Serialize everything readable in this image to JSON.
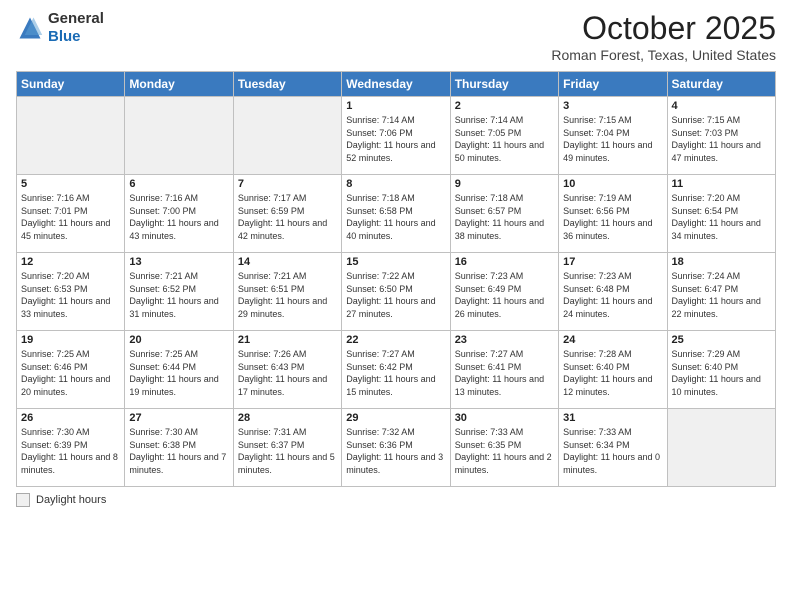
{
  "header": {
    "logo_general": "General",
    "logo_blue": "Blue",
    "month": "October 2025",
    "location": "Roman Forest, Texas, United States"
  },
  "days_of_week": [
    "Sunday",
    "Monday",
    "Tuesday",
    "Wednesday",
    "Thursday",
    "Friday",
    "Saturday"
  ],
  "weeks": [
    [
      {
        "day": "",
        "empty": true
      },
      {
        "day": "",
        "empty": true
      },
      {
        "day": "",
        "empty": true
      },
      {
        "day": "1",
        "sunrise": "7:14 AM",
        "sunset": "7:06 PM",
        "daylight": "11 hours and 52 minutes."
      },
      {
        "day": "2",
        "sunrise": "7:14 AM",
        "sunset": "7:05 PM",
        "daylight": "11 hours and 50 minutes."
      },
      {
        "day": "3",
        "sunrise": "7:15 AM",
        "sunset": "7:04 PM",
        "daylight": "11 hours and 49 minutes."
      },
      {
        "day": "4",
        "sunrise": "7:15 AM",
        "sunset": "7:03 PM",
        "daylight": "11 hours and 47 minutes."
      }
    ],
    [
      {
        "day": "5",
        "sunrise": "7:16 AM",
        "sunset": "7:01 PM",
        "daylight": "11 hours and 45 minutes."
      },
      {
        "day": "6",
        "sunrise": "7:16 AM",
        "sunset": "7:00 PM",
        "daylight": "11 hours and 43 minutes."
      },
      {
        "day": "7",
        "sunrise": "7:17 AM",
        "sunset": "6:59 PM",
        "daylight": "11 hours and 42 minutes."
      },
      {
        "day": "8",
        "sunrise": "7:18 AM",
        "sunset": "6:58 PM",
        "daylight": "11 hours and 40 minutes."
      },
      {
        "day": "9",
        "sunrise": "7:18 AM",
        "sunset": "6:57 PM",
        "daylight": "11 hours and 38 minutes."
      },
      {
        "day": "10",
        "sunrise": "7:19 AM",
        "sunset": "6:56 PM",
        "daylight": "11 hours and 36 minutes."
      },
      {
        "day": "11",
        "sunrise": "7:20 AM",
        "sunset": "6:54 PM",
        "daylight": "11 hours and 34 minutes."
      }
    ],
    [
      {
        "day": "12",
        "sunrise": "7:20 AM",
        "sunset": "6:53 PM",
        "daylight": "11 hours and 33 minutes."
      },
      {
        "day": "13",
        "sunrise": "7:21 AM",
        "sunset": "6:52 PM",
        "daylight": "11 hours and 31 minutes."
      },
      {
        "day": "14",
        "sunrise": "7:21 AM",
        "sunset": "6:51 PM",
        "daylight": "11 hours and 29 minutes."
      },
      {
        "day": "15",
        "sunrise": "7:22 AM",
        "sunset": "6:50 PM",
        "daylight": "11 hours and 27 minutes."
      },
      {
        "day": "16",
        "sunrise": "7:23 AM",
        "sunset": "6:49 PM",
        "daylight": "11 hours and 26 minutes."
      },
      {
        "day": "17",
        "sunrise": "7:23 AM",
        "sunset": "6:48 PM",
        "daylight": "11 hours and 24 minutes."
      },
      {
        "day": "18",
        "sunrise": "7:24 AM",
        "sunset": "6:47 PM",
        "daylight": "11 hours and 22 minutes."
      }
    ],
    [
      {
        "day": "19",
        "sunrise": "7:25 AM",
        "sunset": "6:46 PM",
        "daylight": "11 hours and 20 minutes."
      },
      {
        "day": "20",
        "sunrise": "7:25 AM",
        "sunset": "6:44 PM",
        "daylight": "11 hours and 19 minutes."
      },
      {
        "day": "21",
        "sunrise": "7:26 AM",
        "sunset": "6:43 PM",
        "daylight": "11 hours and 17 minutes."
      },
      {
        "day": "22",
        "sunrise": "7:27 AM",
        "sunset": "6:42 PM",
        "daylight": "11 hours and 15 minutes."
      },
      {
        "day": "23",
        "sunrise": "7:27 AM",
        "sunset": "6:41 PM",
        "daylight": "11 hours and 13 minutes."
      },
      {
        "day": "24",
        "sunrise": "7:28 AM",
        "sunset": "6:40 PM",
        "daylight": "11 hours and 12 minutes."
      },
      {
        "day": "25",
        "sunrise": "7:29 AM",
        "sunset": "6:40 PM",
        "daylight": "11 hours and 10 minutes."
      }
    ],
    [
      {
        "day": "26",
        "sunrise": "7:30 AM",
        "sunset": "6:39 PM",
        "daylight": "11 hours and 8 minutes."
      },
      {
        "day": "27",
        "sunrise": "7:30 AM",
        "sunset": "6:38 PM",
        "daylight": "11 hours and 7 minutes."
      },
      {
        "day": "28",
        "sunrise": "7:31 AM",
        "sunset": "6:37 PM",
        "daylight": "11 hours and 5 minutes."
      },
      {
        "day": "29",
        "sunrise": "7:32 AM",
        "sunset": "6:36 PM",
        "daylight": "11 hours and 3 minutes."
      },
      {
        "day": "30",
        "sunrise": "7:33 AM",
        "sunset": "6:35 PM",
        "daylight": "11 hours and 2 minutes."
      },
      {
        "day": "31",
        "sunrise": "7:33 AM",
        "sunset": "6:34 PM",
        "daylight": "11 hours and 0 minutes."
      },
      {
        "day": "",
        "empty": true
      }
    ]
  ],
  "legend": {
    "label": "Daylight hours"
  }
}
